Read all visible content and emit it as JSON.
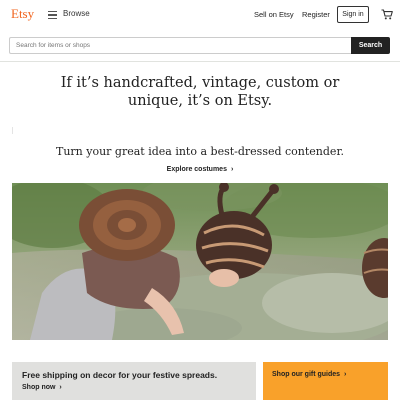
{
  "header": {
    "logo": "Etsy",
    "browse_label": "Browse",
    "sell_label": "Sell on Etsy",
    "register_label": "Register",
    "signin_label": "Sign in"
  },
  "search": {
    "placeholder": "Search for items or shops",
    "button_label": "Search"
  },
  "hero": {
    "title_line1": "If it’s handcrafted, vintage, custom or",
    "title_line2": "unique, it’s on Etsy.",
    "tagline": "Turn your great idea into a best-dressed contender.",
    "cta_label": "Explore costumes",
    "cta_chevron": "›"
  },
  "promos": {
    "shipping_title": "Free shipping on decor for your festive spreads.",
    "shipping_link": "Shop now",
    "shipping_chevron": "›",
    "gift_link": "Shop our gift guides",
    "gift_chevron": "›"
  },
  "colors": {
    "brand": "#f1641e",
    "search_button": "#222222",
    "promo_grey": "#e0e0de",
    "promo_orange": "#f9a12a"
  },
  "icons": [
    "menu-icon",
    "cart-icon"
  ]
}
